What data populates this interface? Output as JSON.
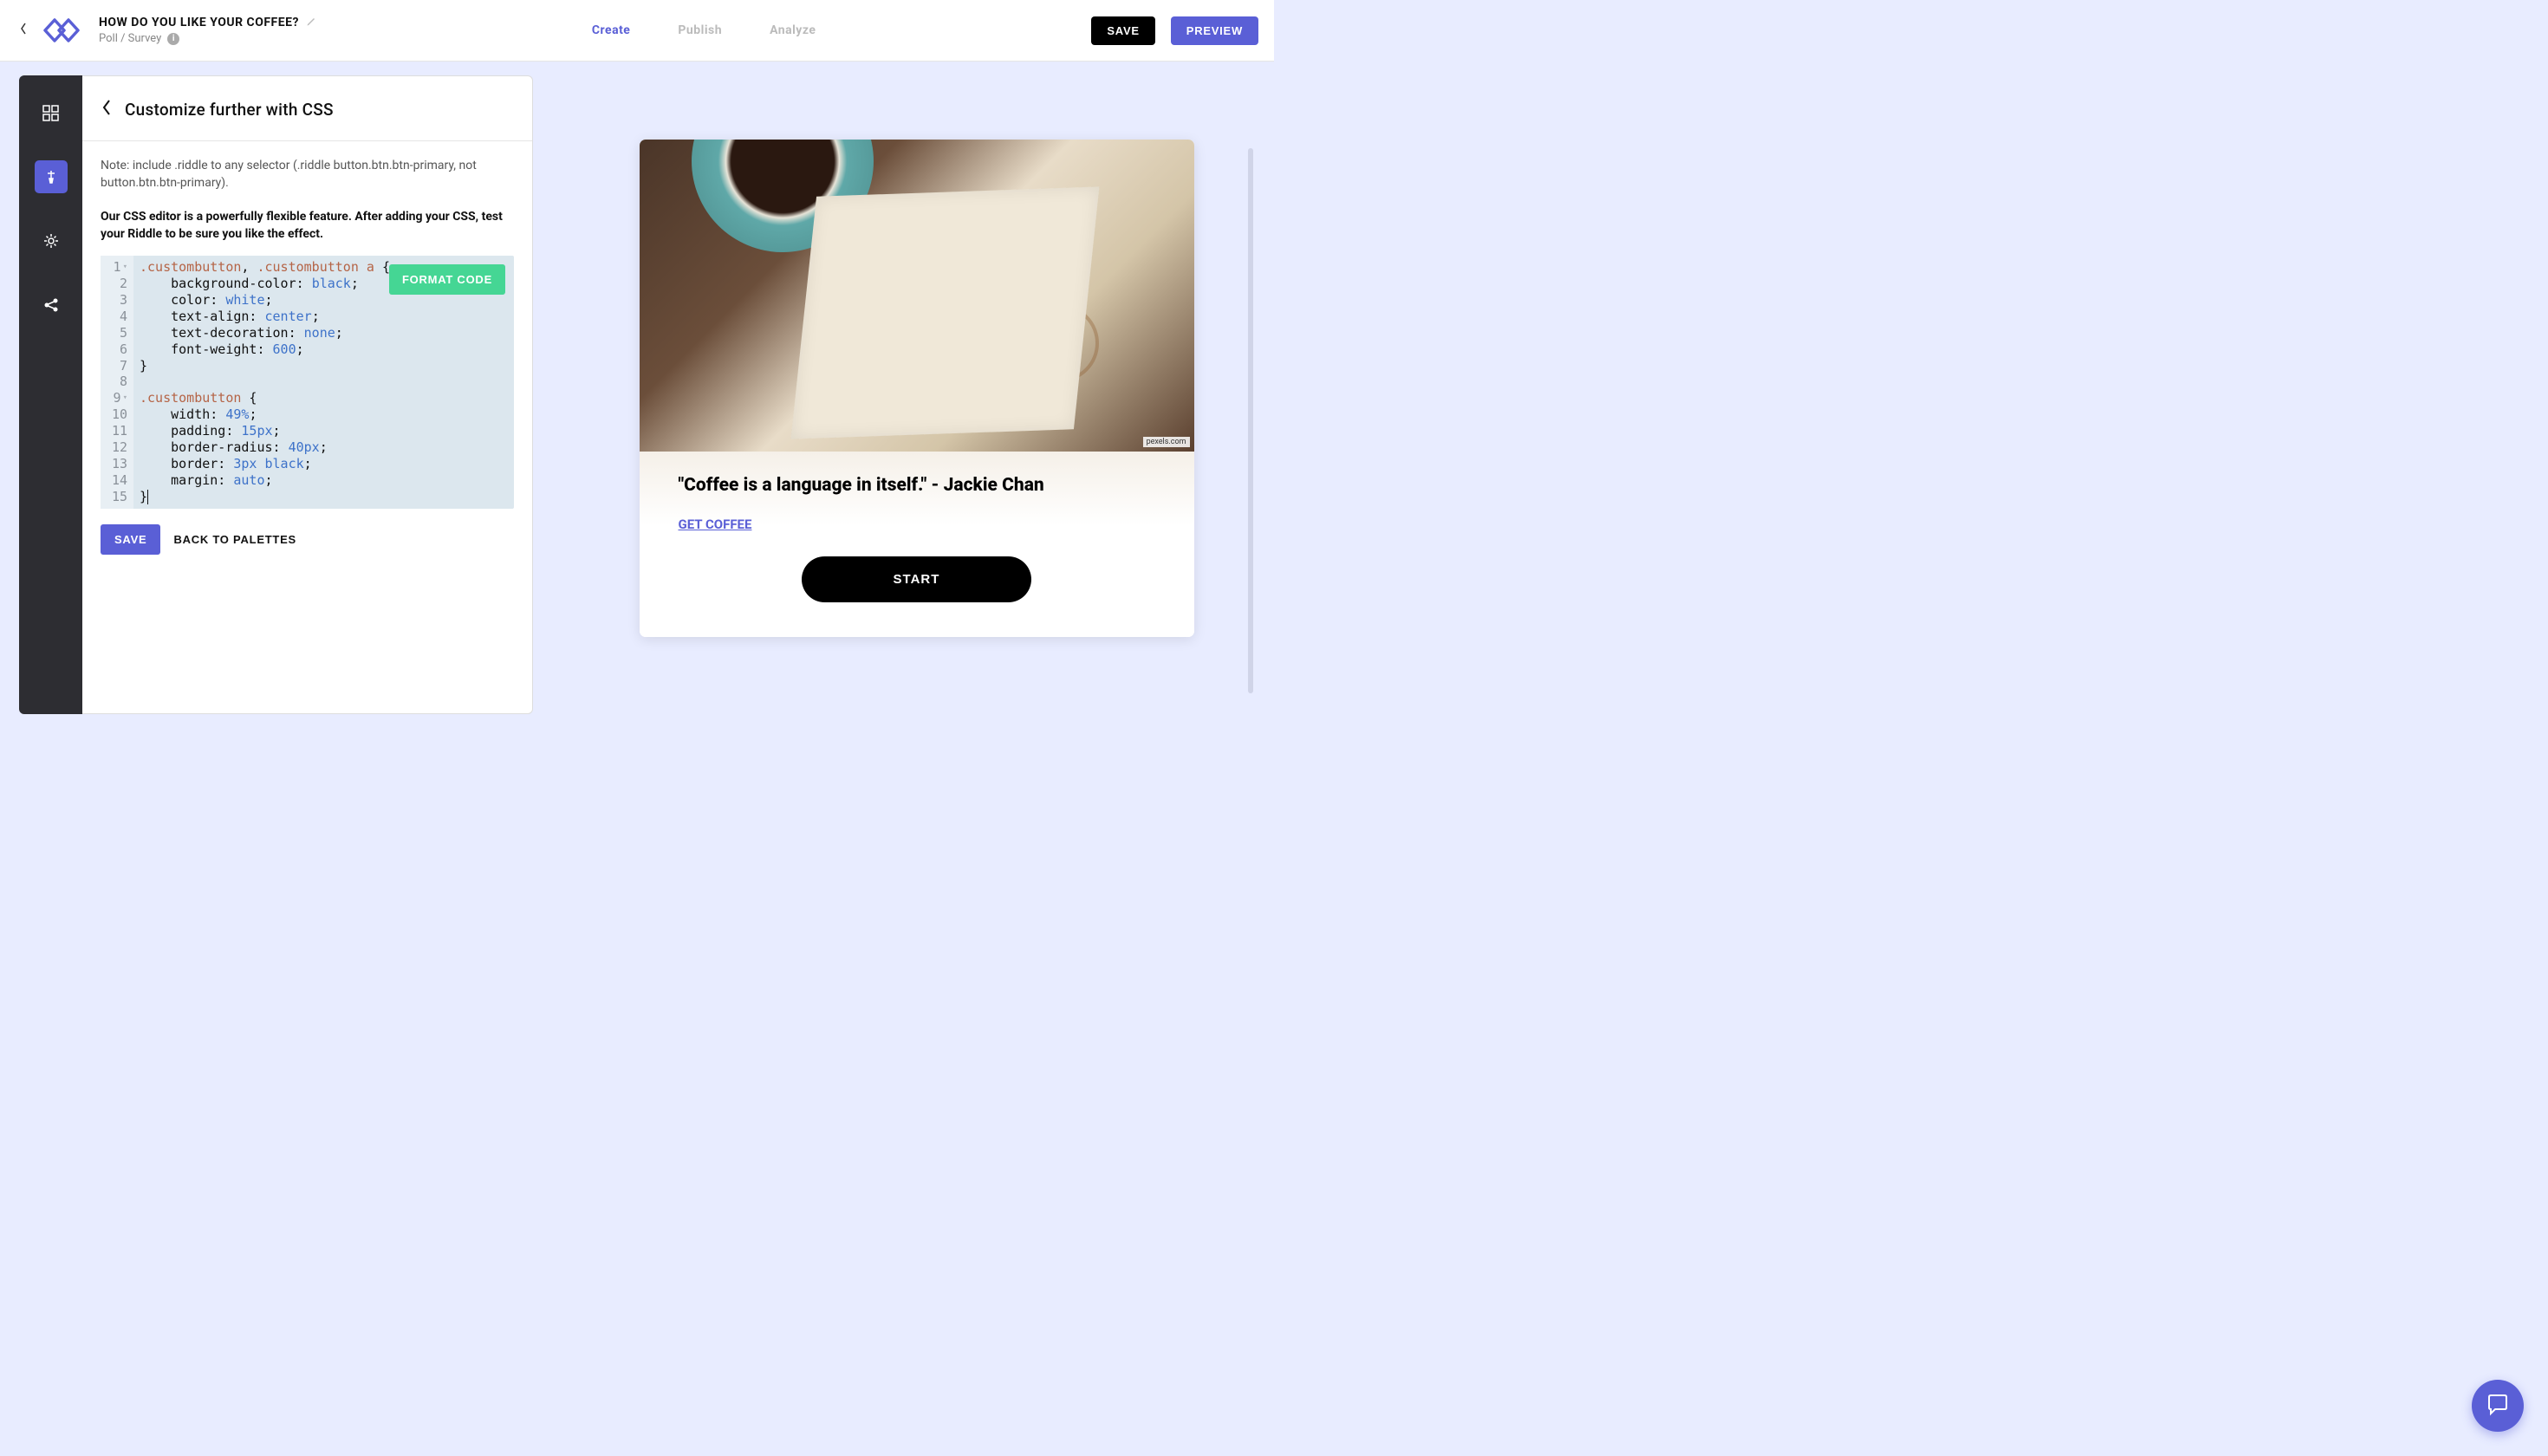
{
  "header": {
    "title": "HOW DO YOU LIKE YOUR COFFEE?",
    "subtitle": "Poll / Survey",
    "nav": {
      "create": "Create",
      "publish": "Publish",
      "analyze": "Analyze"
    },
    "save_label": "SAVE",
    "preview_label": "PREVIEW"
  },
  "panel": {
    "title": "Customize further with CSS",
    "note": "Note: include .riddle to any selector (.riddle button.btn.btn-primary, not button.btn.btn-primary).",
    "bold_note": "Our CSS editor is a powerfully flexible feature. After adding your CSS, test your Riddle to be sure you like the effect.",
    "format_label": "FORMAT CODE",
    "save_label": "SAVE",
    "back_label": "BACK TO PALETTES"
  },
  "code": {
    "lines": [
      {
        "n": "1",
        "fold": true,
        "tokens": [
          {
            "t": ".custombutton",
            "c": "sel"
          },
          {
            "t": ", ",
            "c": "punc"
          },
          {
            "t": ".custombutton a",
            "c": "sel"
          },
          {
            "t": " {",
            "c": "brace"
          }
        ]
      },
      {
        "n": "2",
        "tokens": [
          {
            "t": "    background-color: ",
            "c": "prop"
          },
          {
            "t": "black",
            "c": "val"
          },
          {
            "t": ";",
            "c": "punc"
          }
        ]
      },
      {
        "n": "3",
        "tokens": [
          {
            "t": "    color: ",
            "c": "prop"
          },
          {
            "t": "white",
            "c": "val"
          },
          {
            "t": ";",
            "c": "punc"
          }
        ]
      },
      {
        "n": "4",
        "tokens": [
          {
            "t": "    text-align: ",
            "c": "prop"
          },
          {
            "t": "center",
            "c": "val"
          },
          {
            "t": ";",
            "c": "punc"
          }
        ]
      },
      {
        "n": "5",
        "tokens": [
          {
            "t": "    text-decoration: ",
            "c": "prop"
          },
          {
            "t": "none",
            "c": "val"
          },
          {
            "t": ";",
            "c": "punc"
          }
        ]
      },
      {
        "n": "6",
        "tokens": [
          {
            "t": "    font-weight: ",
            "c": "prop"
          },
          {
            "t": "600",
            "c": "val"
          },
          {
            "t": ";",
            "c": "punc"
          }
        ]
      },
      {
        "n": "7",
        "tokens": [
          {
            "t": "}",
            "c": "brace"
          }
        ]
      },
      {
        "n": "8",
        "tokens": []
      },
      {
        "n": "9",
        "fold": true,
        "tokens": [
          {
            "t": ".custombutton",
            "c": "sel"
          },
          {
            "t": " {",
            "c": "brace"
          }
        ]
      },
      {
        "n": "10",
        "tokens": [
          {
            "t": "    width: ",
            "c": "prop"
          },
          {
            "t": "49%",
            "c": "val"
          },
          {
            "t": ";",
            "c": "punc"
          }
        ]
      },
      {
        "n": "11",
        "tokens": [
          {
            "t": "    padding: ",
            "c": "prop"
          },
          {
            "t": "15px",
            "c": "val"
          },
          {
            "t": ";",
            "c": "punc"
          }
        ]
      },
      {
        "n": "12",
        "tokens": [
          {
            "t": "    border-radius: ",
            "c": "prop"
          },
          {
            "t": "40px",
            "c": "val"
          },
          {
            "t": ";",
            "c": "punc"
          }
        ]
      },
      {
        "n": "13",
        "tokens": [
          {
            "t": "    border: ",
            "c": "prop"
          },
          {
            "t": "3px black",
            "c": "val"
          },
          {
            "t": ";",
            "c": "punc"
          }
        ]
      },
      {
        "n": "14",
        "tokens": [
          {
            "t": "    margin: ",
            "c": "prop"
          },
          {
            "t": "auto",
            "c": "val"
          },
          {
            "t": ";",
            "c": "punc"
          }
        ]
      },
      {
        "n": "15",
        "tokens": [
          {
            "t": "}",
            "c": "brace"
          }
        ],
        "cursor": true
      }
    ]
  },
  "preview": {
    "credit": "pexels.com",
    "quote": "\"Coffee is a language in itself.\" - Jackie Chan",
    "link_label": "GET COFFEE",
    "start_label": "START"
  }
}
